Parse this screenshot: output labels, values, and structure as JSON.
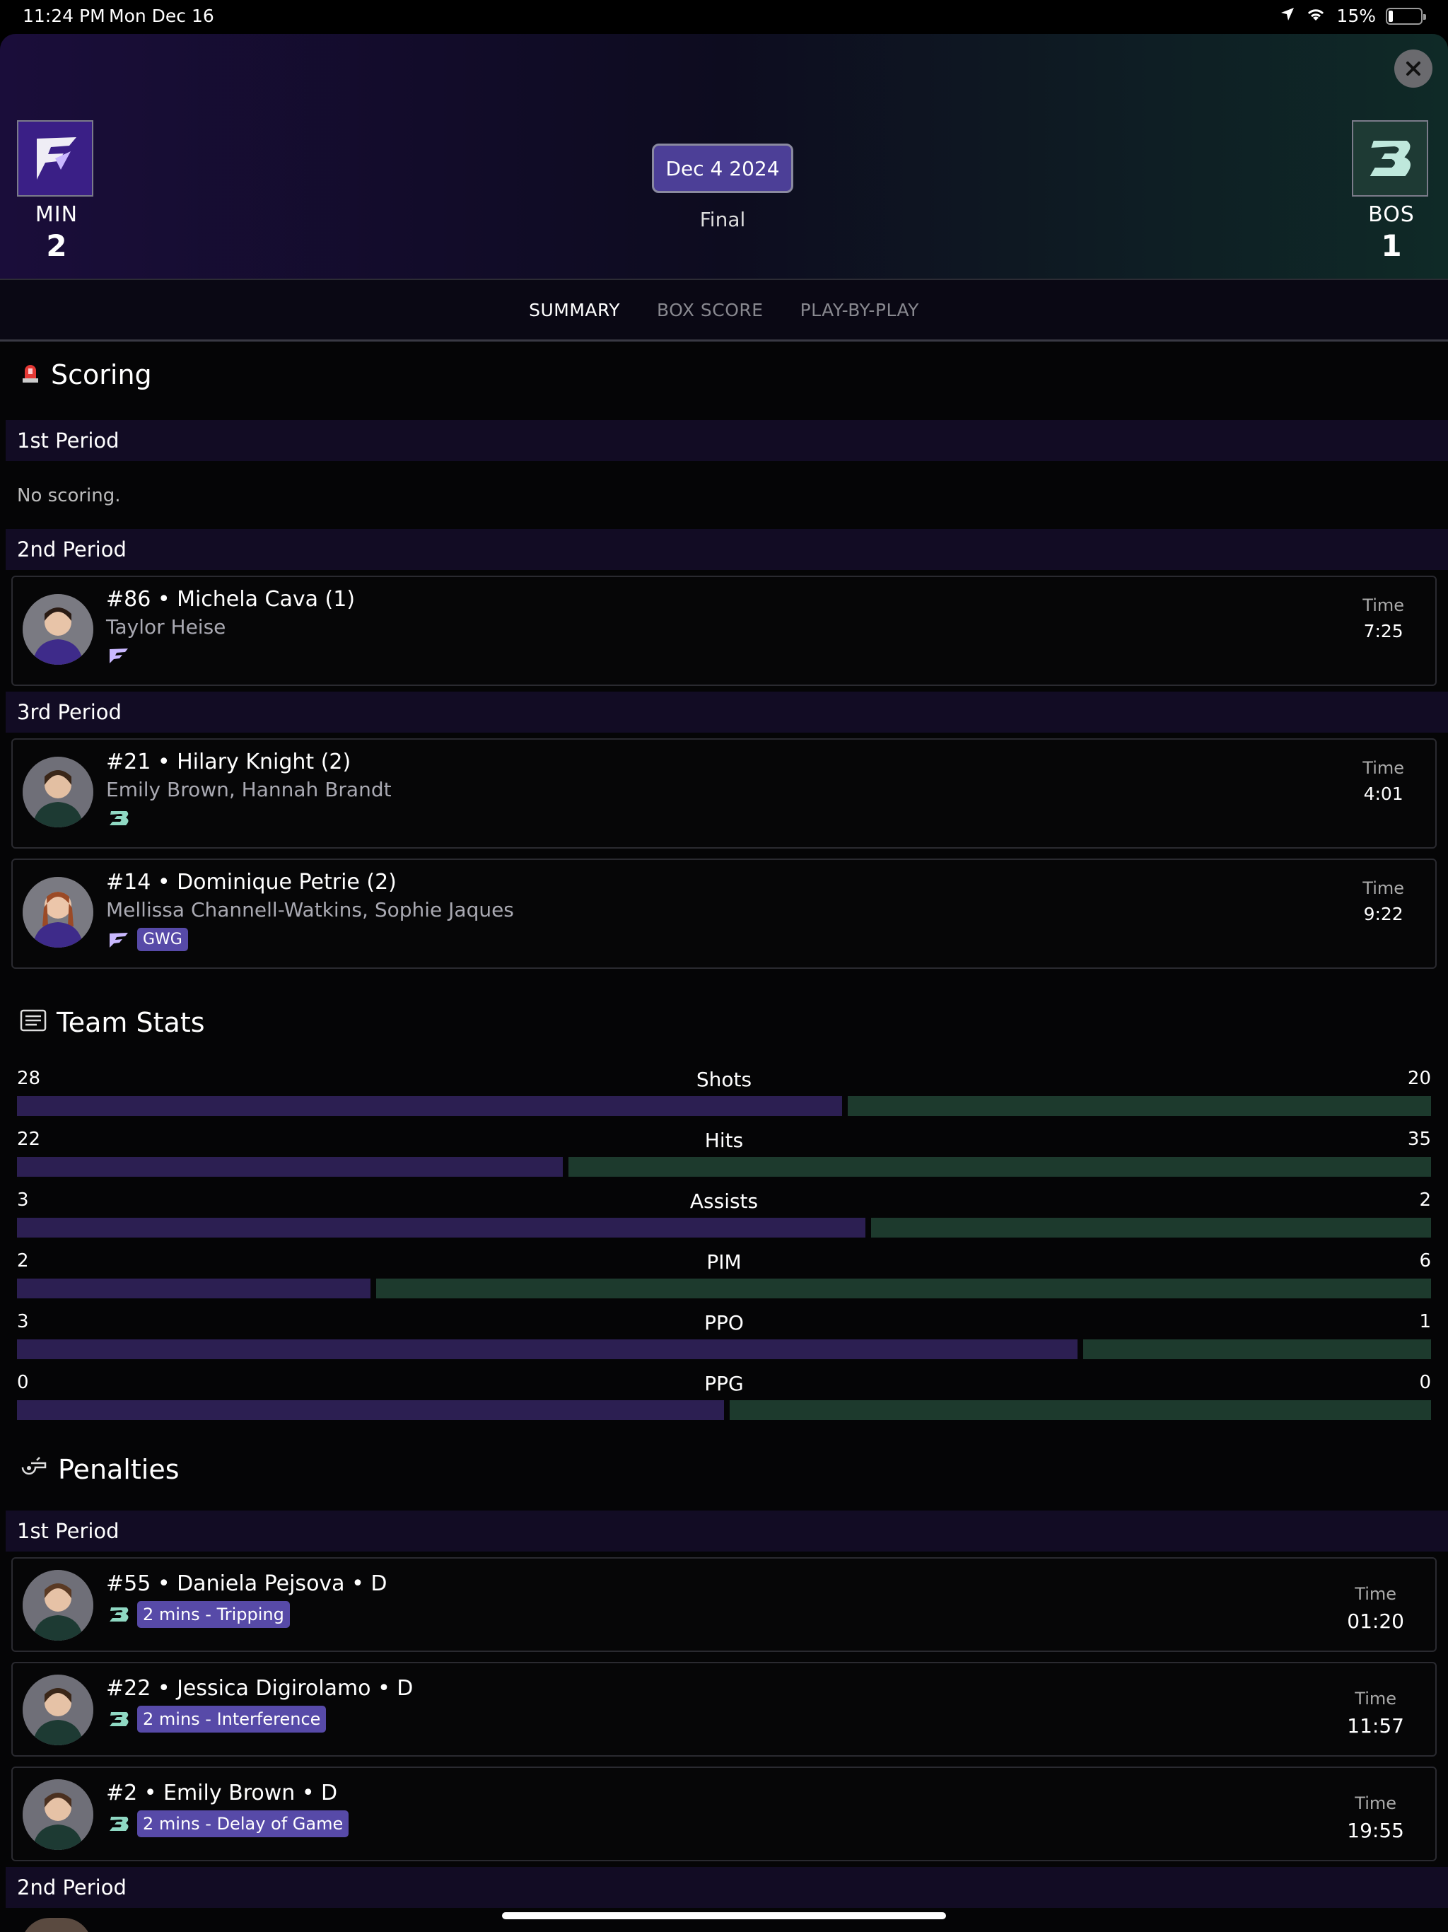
{
  "status": {
    "time": "11:24 PM",
    "date": "Mon Dec 16",
    "battery": "15%"
  },
  "game": {
    "home": {
      "abbr": "MIN",
      "score": "2",
      "color": "#3a1f86"
    },
    "away": {
      "abbr": "BOS",
      "score": "1",
      "color": "#1e3a34"
    },
    "date": "Dec 4 2024",
    "status": "Final"
  },
  "tabs": [
    "SUMMARY",
    "BOX SCORE",
    "PLAY-BY-PLAY"
  ],
  "scoring": {
    "title": "Scoring",
    "periods": [
      "1st Period",
      "2nd Period",
      "3rd Period"
    ],
    "no_scoring": "No scoring.",
    "goals": [
      {
        "scorer": "#86 • Michela Cava (1)",
        "assists": "Taylor Heise",
        "team": "MIN",
        "time_label": "Time",
        "time": "7:25"
      },
      {
        "scorer": "#21 • Hilary Knight (2)",
        "assists": "Emily Brown, Hannah Brandt",
        "team": "BOS",
        "time_label": "Time",
        "time": "4:01"
      },
      {
        "scorer": "#14 • Dominique Petrie (2)",
        "assists": "Mellissa Channell-Watkins, Sophie Jaques",
        "team": "MIN",
        "badge": "GWG",
        "time_label": "Time",
        "time": "9:22"
      }
    ]
  },
  "team_stats": {
    "title": "Team Stats",
    "rows": [
      {
        "label": "Shots",
        "home": 28,
        "away": 20
      },
      {
        "label": "Hits",
        "home": 22,
        "away": 35
      },
      {
        "label": "Assists",
        "home": 3,
        "away": 2
      },
      {
        "label": "PIM",
        "home": 2,
        "away": 6
      },
      {
        "label": "PPO",
        "home": 3,
        "away": 1
      },
      {
        "label": "PPG",
        "home": 0,
        "away": 0
      }
    ]
  },
  "penalties": {
    "title": "Penalties",
    "periods": [
      "1st Period",
      "2nd Period"
    ],
    "items": [
      {
        "player": "#55 • Daniela Pejsova  • D",
        "infraction": "2 mins - Tripping",
        "time_label": "Time",
        "time": "01:20"
      },
      {
        "player": "#22 • Jessica Digirolamo  • D",
        "infraction": "2 mins - Interference",
        "time_label": "Time",
        "time": "11:57"
      },
      {
        "player": "#2 • Emily Brown  • D",
        "infraction": "2 mins - Delay of Game",
        "time_label": "Time",
        "time": "19:55"
      }
    ]
  }
}
